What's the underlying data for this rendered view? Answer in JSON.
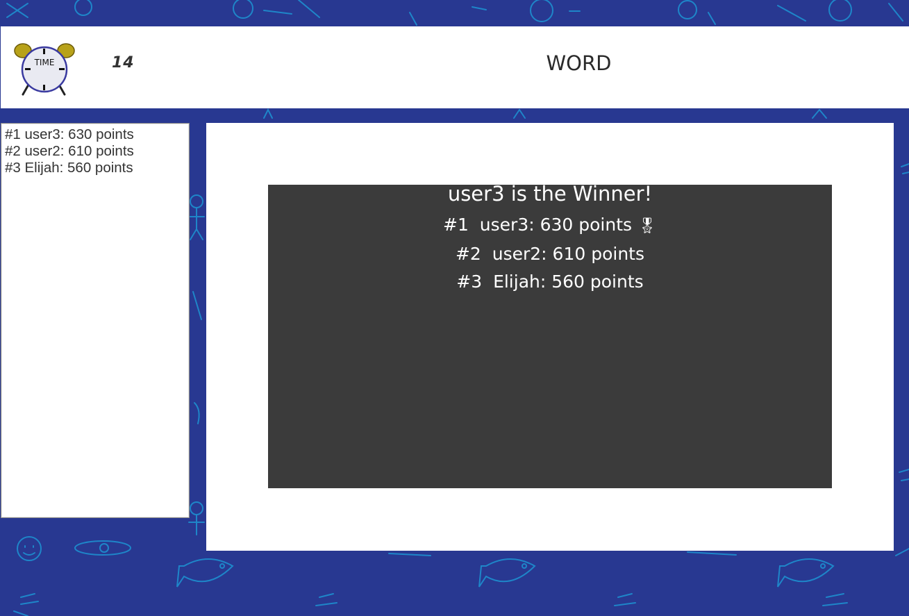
{
  "header": {
    "clock_label": "TIME",
    "timer": "14",
    "word": "WORD"
  },
  "scoreboard": {
    "rows": [
      "#1 user3: 630 points",
      "#2 user2: 610 points",
      "#3 Elijah: 560 points"
    ]
  },
  "results": {
    "winner_title": "user3 is the Winner!",
    "lines": [
      {
        "rank": "#1",
        "text": "user3: 630 points",
        "medal": "🎖"
      },
      {
        "rank": "#2",
        "text": "user2: 610 points",
        "medal": ""
      },
      {
        "rank": "#3",
        "text": "Elijah: 560 points",
        "medal": ""
      }
    ]
  },
  "colors": {
    "background": "#283891",
    "doodle": "#1e86c9",
    "panel": "#ffffff",
    "overlay": "#3b3b3b"
  }
}
